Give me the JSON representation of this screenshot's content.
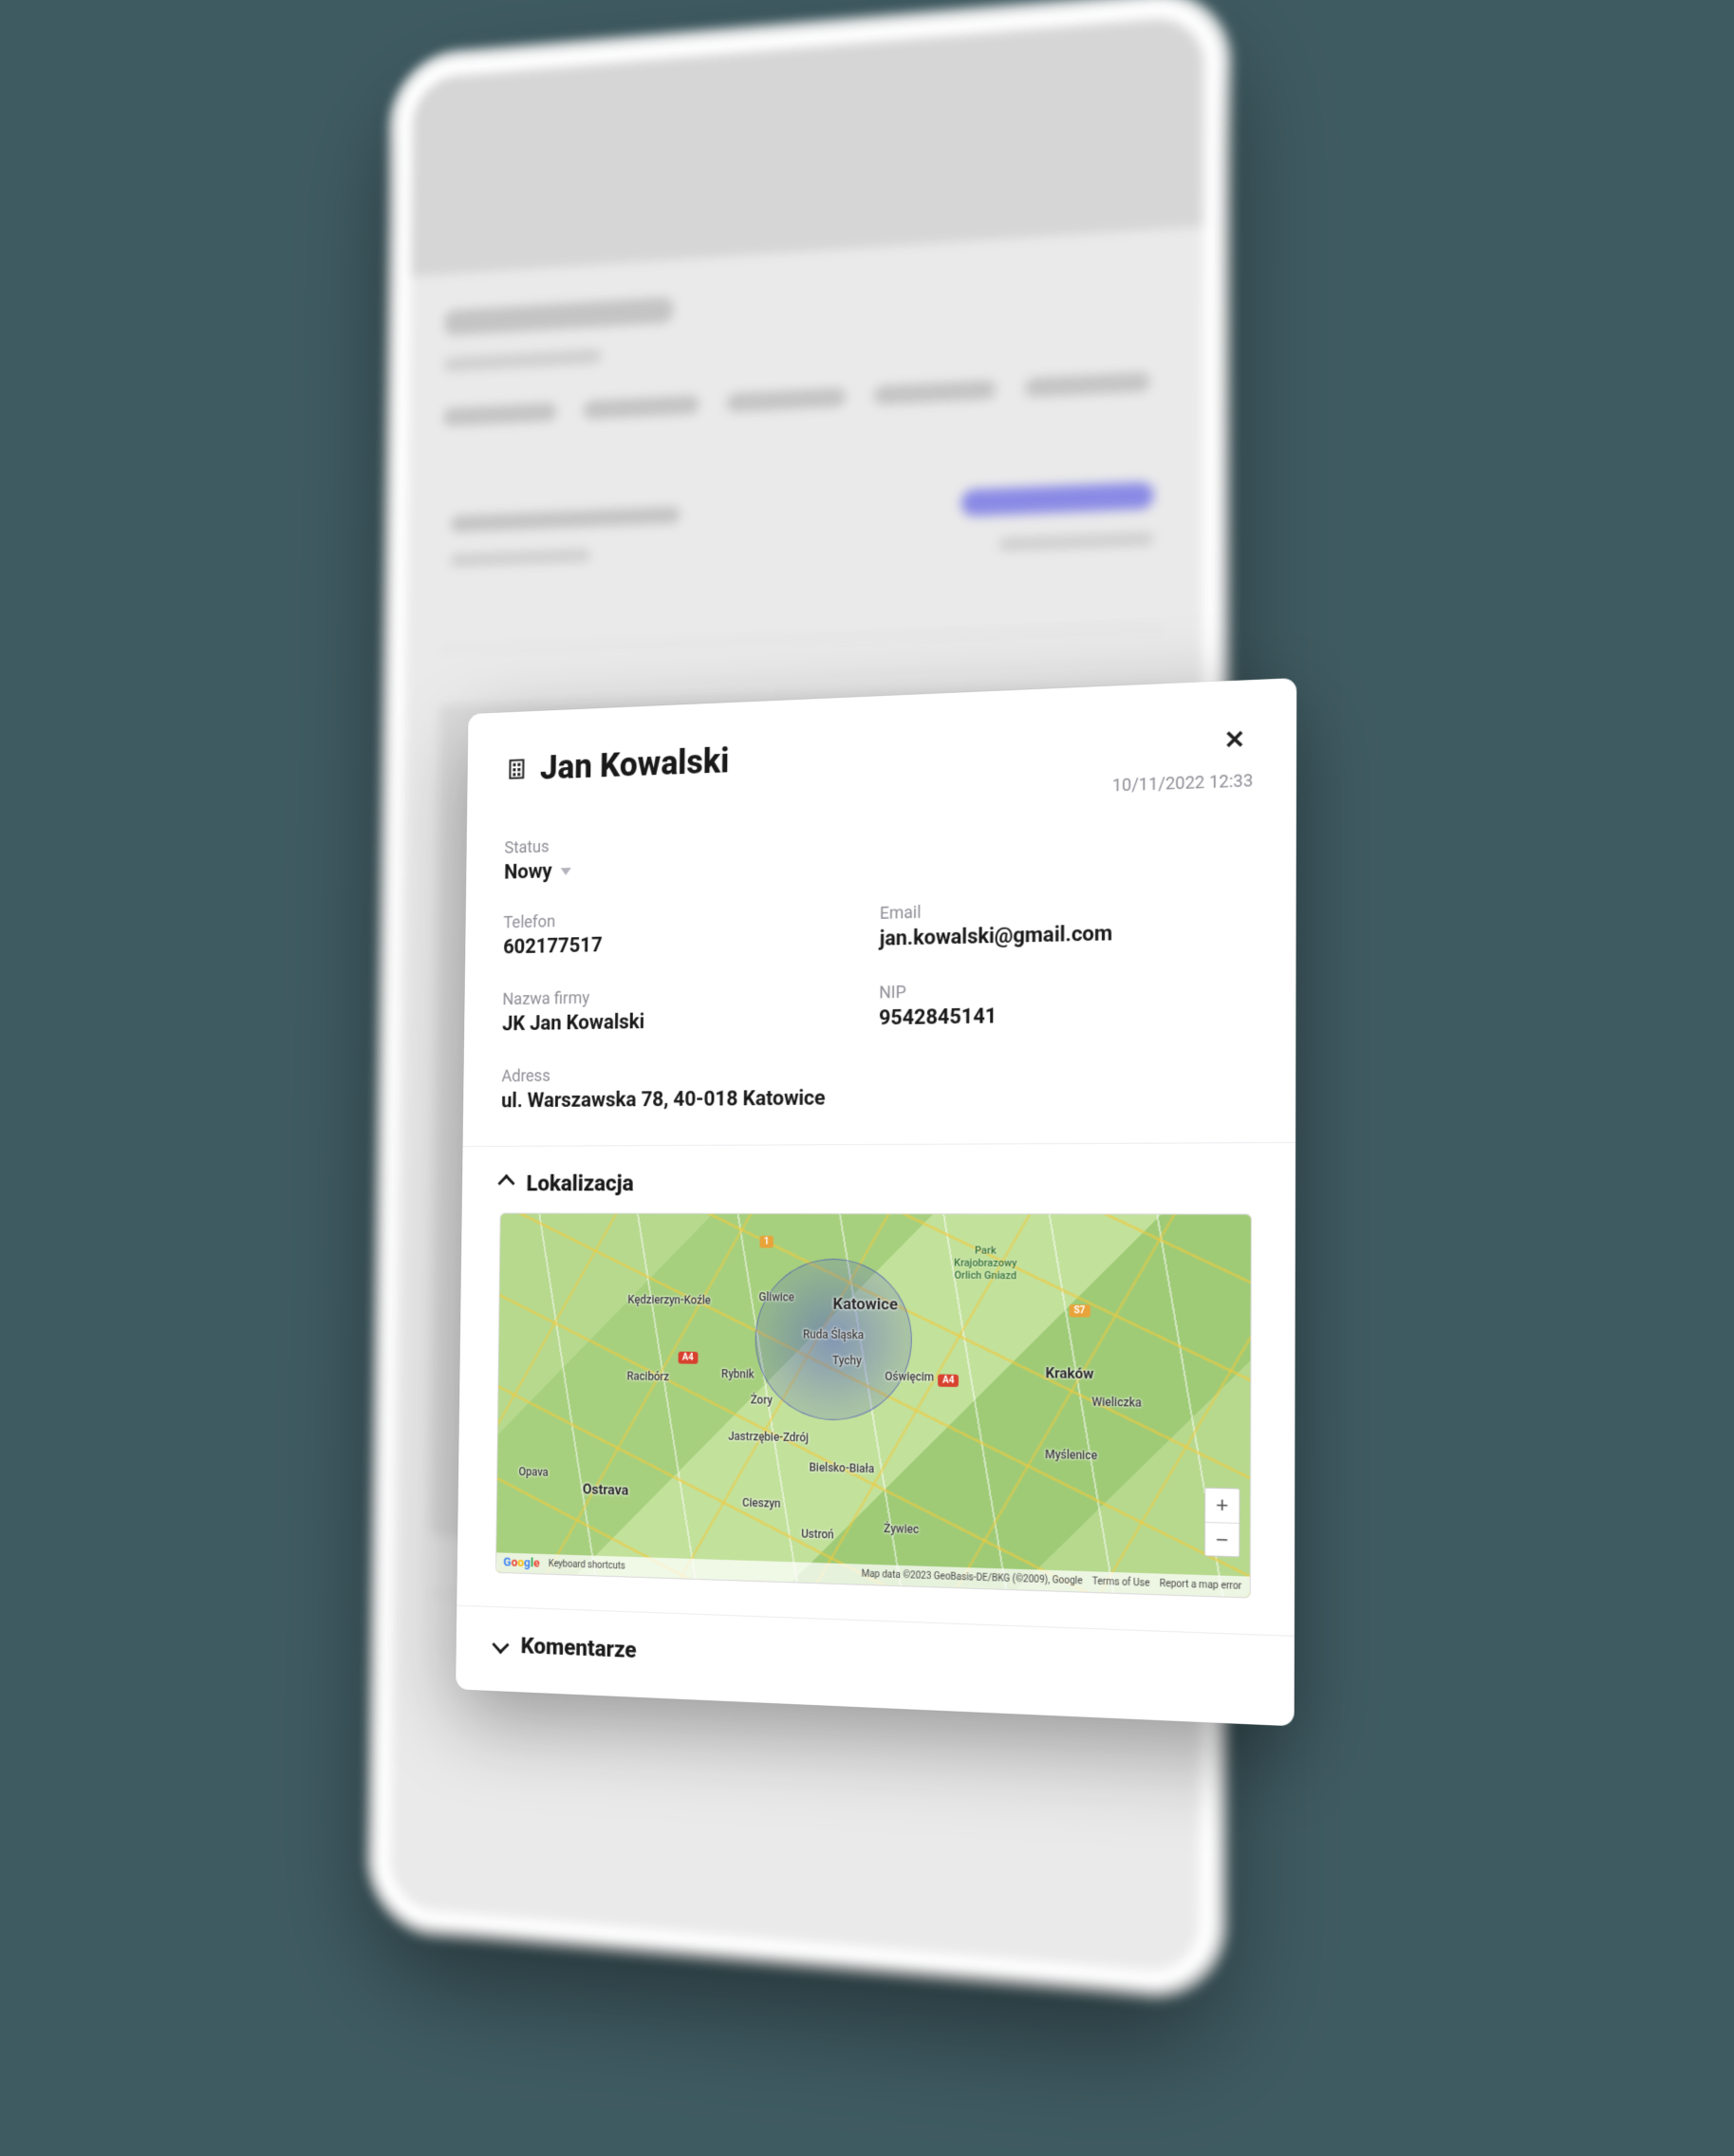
{
  "card": {
    "title": "Jan Kowalski",
    "timestamp": "10/11/2022 12:33",
    "status": {
      "label": "Status",
      "value": "Nowy"
    },
    "phone": {
      "label": "Telefon",
      "value": "602177517"
    },
    "email": {
      "label": "Email",
      "value": "jan.kowalski@gmail.com"
    },
    "company": {
      "label": "Nazwa firmy",
      "value": "JK Jan Kowalski"
    },
    "nip": {
      "label": "NIP",
      "value": "9542845141"
    },
    "address": {
      "label": "Adress",
      "value": "ul. Warszawska 78, 40-018 Katowice"
    },
    "sections": {
      "location": "Lokalizacja",
      "comments": "Komentarze"
    }
  },
  "map": {
    "main_cities": {
      "katowice": "Katowice",
      "krakow": "Kraków",
      "ostrava": "Ostrava",
      "opava": "Opava"
    },
    "small_cities": {
      "gliwice": "Gliwice",
      "ruda": "Ruda Śląska",
      "tychy": "Tychy",
      "oswiecim": "Oświęcim",
      "rybnik": "Rybnik",
      "zory": "Żory",
      "raciborz": "Racibórz",
      "kedz": "Kędzierzyn-Koźle",
      "jastrz": "Jastrzębie-Zdrój",
      "bielsko": "Bielsko-Biała",
      "cieszyn": "Cieszyn",
      "ustron": "Ustroń",
      "zywiec": "Żywiec",
      "wieliczka": "Wieliczka",
      "myslenice": "Myślenice"
    },
    "park": {
      "l1": "Park",
      "l2": "Krajobrazowy",
      "l3": "Orlich Gniazd"
    },
    "badges": {
      "a4a": "A4",
      "a4b": "A4",
      "s7": "S7",
      "e1": "1"
    },
    "zoom": {
      "in": "+",
      "out": "−"
    },
    "footer": {
      "shortcuts": "Keyboard shortcuts",
      "mapdata": "Map data ©2023 GeoBasis-DE/BKG (©2009), Google",
      "terms": "Terms of Use",
      "report": "Report a map error"
    },
    "logo": [
      "G",
      "o",
      "o",
      "g",
      "l",
      "e"
    ]
  }
}
